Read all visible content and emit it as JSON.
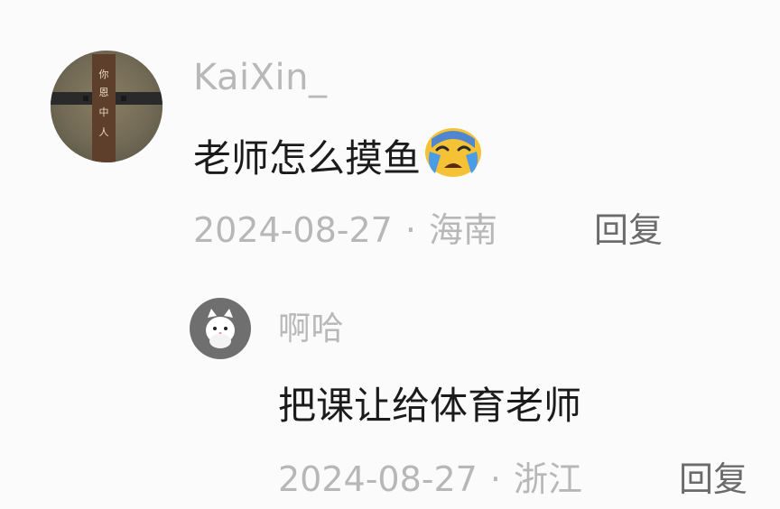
{
  "comment": {
    "username": "KaiXin_",
    "text": "老师怎么摸鱼",
    "emoji": "crying-face",
    "date": "2024-08-27",
    "separator": "·",
    "location": "海南",
    "reply_label": "回复"
  },
  "reply": {
    "username": "啊哈",
    "text": "把课让给体育老师",
    "date": "2024-08-27",
    "separator": "·",
    "location": "浙江",
    "reply_label": "回复"
  }
}
